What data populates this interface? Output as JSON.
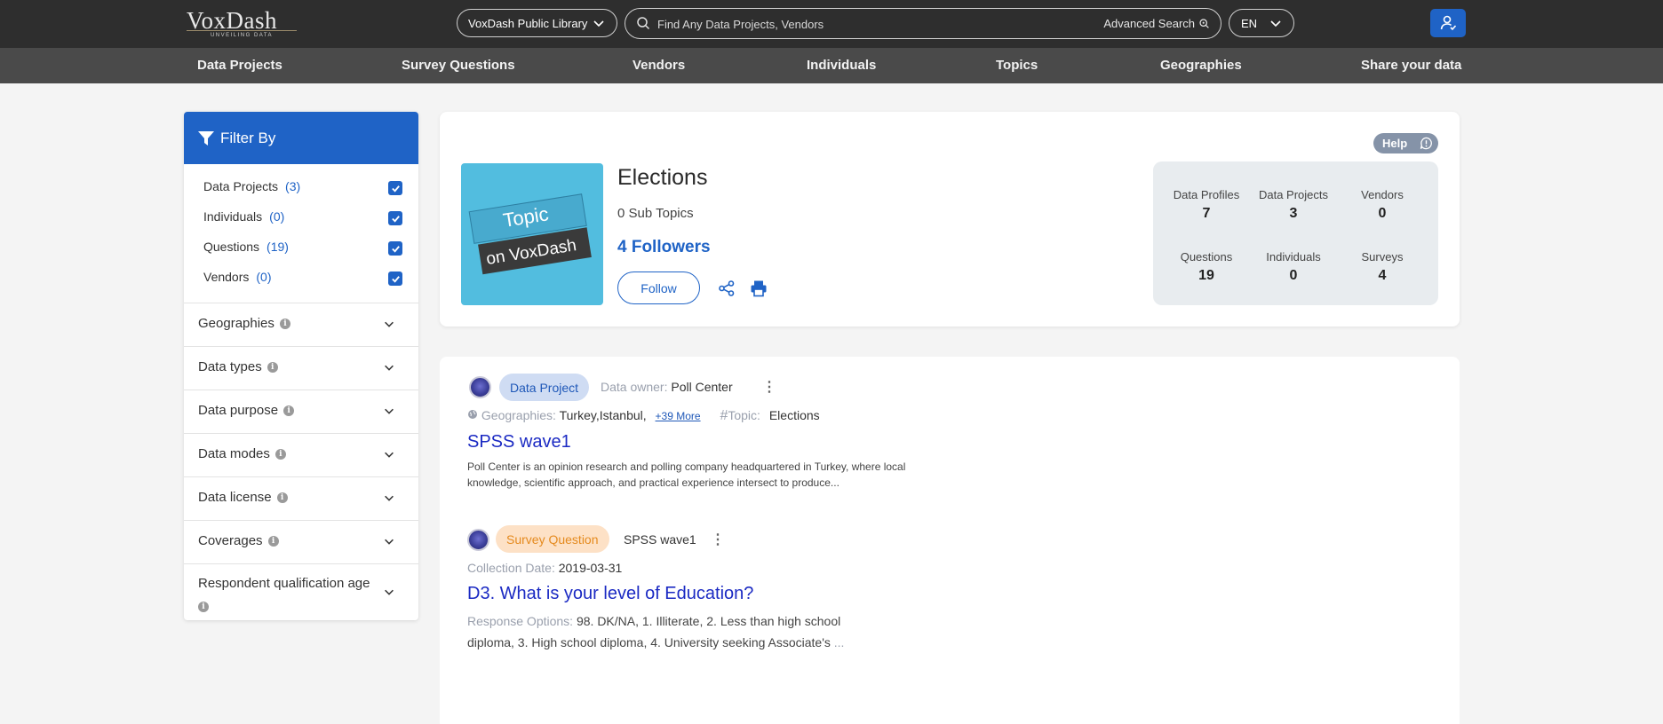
{
  "header": {
    "logo": "VoxDash",
    "logo_tagline": "UNVEILING DATA",
    "library_select": "VoxDash Public Library",
    "search_placeholder": "Find Any Data Projects, Vendors",
    "advanced_search": "Advanced Search",
    "language": "EN"
  },
  "nav": [
    "Data Projects",
    "Survey Questions",
    "Vendors",
    "Individuals",
    "Topics",
    "Geographies",
    "Share your data"
  ],
  "sidebar": {
    "title": "Filter By",
    "types": [
      {
        "label": "Data Projects",
        "count": "(3)",
        "checked": true
      },
      {
        "label": "Individuals",
        "count": "(0)",
        "checked": true
      },
      {
        "label": "Questions",
        "count": "(19)",
        "checked": true
      },
      {
        "label": "Vendors",
        "count": "(0)",
        "checked": true
      }
    ],
    "facets": [
      "Geographies",
      "Data types",
      "Data purpose",
      "Data modes",
      "Data license",
      "Coverages",
      "Respondent qualification age"
    ]
  },
  "topic": {
    "help": "Help",
    "image_line1": "Topic",
    "image_line2": "on VoxDash",
    "title": "Elections",
    "subtopics": "0 Sub Topics",
    "followers": "4 Followers",
    "follow_label": "Follow",
    "stats": [
      {
        "label": "Data Profiles",
        "value": "7"
      },
      {
        "label": "Data Projects",
        "value": "3"
      },
      {
        "label": "Vendors",
        "value": "0"
      },
      {
        "label": "Questions",
        "value": "19"
      },
      {
        "label": "Individuals",
        "value": "0"
      },
      {
        "label": "Surveys",
        "value": "4"
      }
    ]
  },
  "results": [
    {
      "badge": "Data Project",
      "owner_label": "Data owner:",
      "owner": "Poll Center",
      "geo_label": "Geographies:",
      "geo": "Turkey,Istanbul,",
      "more": "+39 More",
      "topic_label": "Topic:",
      "topic": "Elections",
      "title": "SPSS wave1",
      "description": "Poll Center is an opinion research and polling company headquartered in Turkey, where local knowledge, scientific approach, and practical experience intersect to produce..."
    },
    {
      "badge": "Survey Question",
      "source": "SPSS wave1",
      "date_label": "Collection Date:",
      "date": "2019-03-31",
      "title": "D3. What is your level of Education?",
      "response_label": "Response Options:",
      "response_line1": "98. DK/NA, 1. Illiterate, 2. Less than high school",
      "response_line2": "diploma, 3. High school diploma, 4. University seeking Associate's",
      "ellipsis": "..."
    }
  ],
  "colors": {
    "primary": "#1f63c6",
    "topbar": "#2e2e2e",
    "navbar": "#4a4a4a",
    "link": "#1b2ac3",
    "topic_bg": "#52bddf"
  }
}
